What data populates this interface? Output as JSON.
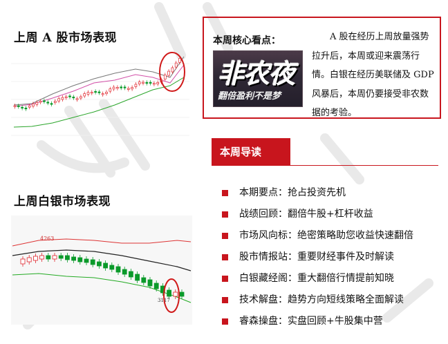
{
  "sections": {
    "a_share_title": "上周 A 股市场表现",
    "silver_title": "上周白银市场表现"
  },
  "charts": {
    "a_share_label": "",
    "silver_high_label": "4263",
    "silver_low_label": "3117"
  },
  "core": {
    "heading": "本周核心看点：",
    "thumb_main": "非农夜",
    "thumb_sub": "翻倍盈利不是梦",
    "text": "A 股在经历上周放量强势拉升后，本周或迎来震荡行情。白银在经历美联储及 GDP 风暴后，本周仍要接受非农数据的考验。"
  },
  "guide": {
    "title": "本周导读",
    "items": [
      "本期要点：抢占投资先机",
      "战绩回顾：翻倍牛股+杠杆收益",
      "市场风向标：绝密策略助您收益快速翻倍",
      "股市情报站：重要财经事件及时解读",
      "白银藏经阁：重大翻倍行情提前知晓",
      "技术解盘：趋势方向短线策略全面解读",
      "睿森操盘：实盘回顾+牛股集中营"
    ]
  },
  "colors": {
    "accent": "#c8151d",
    "up": "#e0242b",
    "down": "#0a9a2a"
  }
}
